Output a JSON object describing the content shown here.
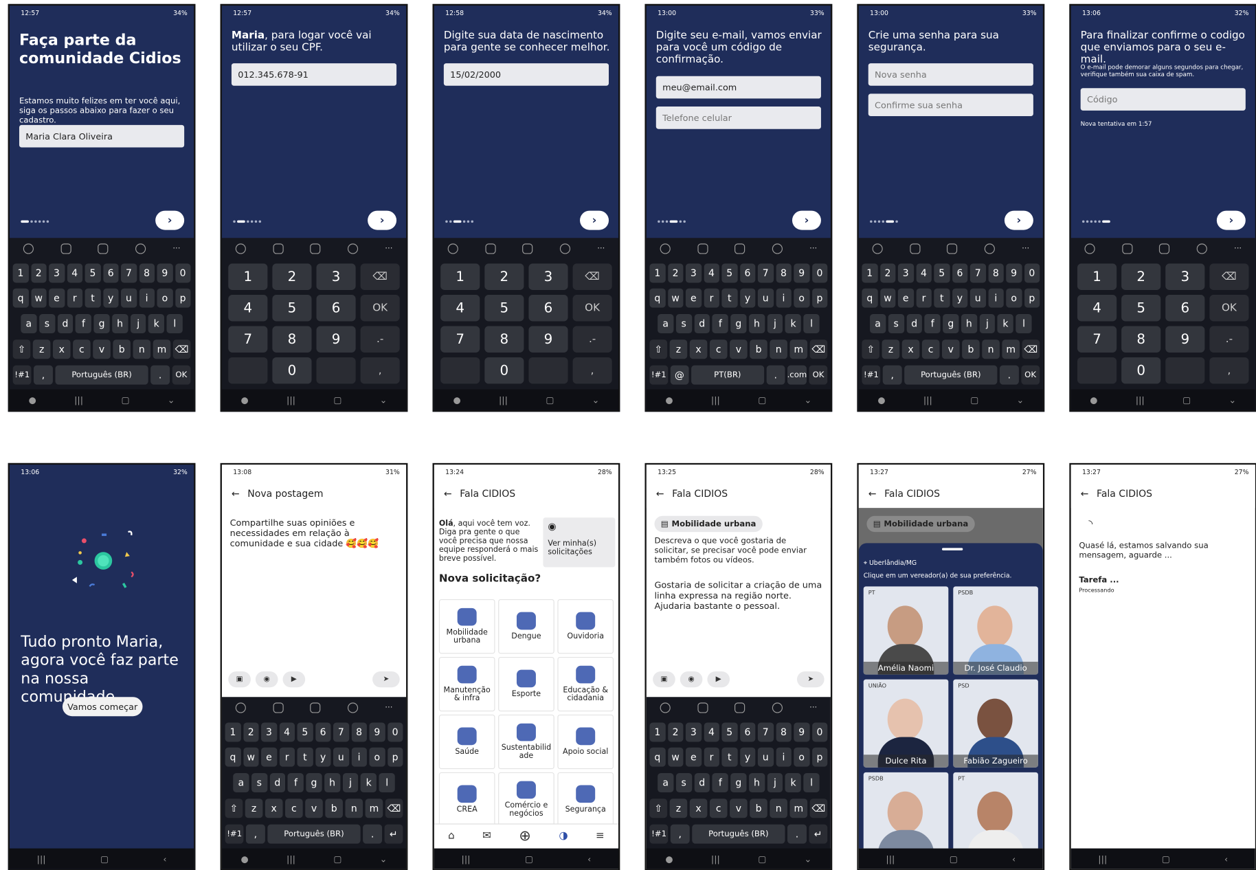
{
  "screens": {
    "s1": {
      "time": "12:57",
      "battery": "34%",
      "title": "Faça parte da comunidade Cidios",
      "subtitle": "Estamos muito felizes em ter você aqui, siga os passos abaixo para fazer o seu cadastro.",
      "name_value": "Maria Clara Oliveira",
      "lang": "Português (BR)",
      "ok": "OK",
      "sym": "!#1"
    },
    "s2": {
      "time": "12:57",
      "battery": "34%",
      "name_bold": "Maria",
      "question": ", para logar você vai utilizar o seu CPF.",
      "cpf_value": "012.345.678-91"
    },
    "s3": {
      "time": "12:58",
      "battery": "34%",
      "question": "Digite sua data de nascimento para gente se conhecer melhor.",
      "date_value": "15/02/2000"
    },
    "s4": {
      "time": "13:00",
      "battery": "33%",
      "question": "Digite seu e-mail, vamos enviar para você um código de confirmação.",
      "email_value": "meu@email.com",
      "phone_placeholder": "Telefone celular",
      "lang": "PT(BR)",
      "com": ".com",
      "at": "@"
    },
    "s5": {
      "time": "13:00",
      "battery": "33%",
      "question": "Crie uma senha para sua segurança.",
      "pass_placeholder": "Nova senha",
      "confirm_placeholder": "Confirme sua senha"
    },
    "s6": {
      "time": "13:06",
      "battery": "32%",
      "question": "Para finalizar confirme o codigo que enviamos para o seu e-mail.",
      "note": "O e-mail pode demorar alguns segundos para chegar, verifique também sua caixa de spam.",
      "code_placeholder": "Código",
      "retry": "Nova tentativa em 1:57"
    },
    "s7": {
      "time": "13:06",
      "battery": "32%",
      "title": "Tudo pronto Maria, agora você faz parte na nossa comunidade.",
      "button": "Vamos começar"
    },
    "s8": {
      "time": "13:08",
      "battery": "31%",
      "header": "Nova postagem",
      "text": "Compartilhe suas opiniões e necessidades em relação à comunidade e sua cidade 🥰🥰🥰"
    },
    "s9": {
      "time": "13:24",
      "battery": "28%",
      "header": "Fala CIDIOS",
      "intro_bold": "Olá",
      "intro": ", aqui você tem voz. Diga pra gente o que você precisa que nossa equipe responderá o mais breve possível.",
      "view_mine": "Ver minha(s) solicitações",
      "new_request": "Nova solicitação?",
      "tiles": [
        "Mobilidade urbana",
        "Dengue",
        "Ouvidoria",
        "Manutenção & infra",
        "Esporte",
        "Educação & cidadania",
        "Saúde",
        "Sustentabilid ade",
        "Apoio social",
        "CREA",
        "Comércio e negócios",
        "Segurança"
      ]
    },
    "s10": {
      "time": "13:25",
      "battery": "28%",
      "header": "Fala CIDIOS",
      "chip": "Mobilidade urbana",
      "prompt": "Descreva o que você gostaria de solicitar, se precisar você pode enviar também fotos ou vídeos.",
      "message": "Gostaria de solicitar a criação de uma linha expressa na região norte. Ajudaria bastante o pessoal."
    },
    "s11": {
      "time": "13:27",
      "battery": "27%",
      "header": "Fala CIDIOS",
      "chip": "Mobilidade urbana",
      "location": "Uberlândia/MG",
      "instruction": "Clique em um vereador(a) de sua preferência.",
      "cards": [
        {
          "party": "PT",
          "name": "Amélia Naomi"
        },
        {
          "party": "PSDB",
          "name": "Dr. José Claudio"
        },
        {
          "party": "UNIÃO",
          "name": "Dulce Rita"
        },
        {
          "party": "PSD",
          "name": "Fabião Zagueiro"
        },
        {
          "party": "PSDB",
          "name": ""
        },
        {
          "party": "PT",
          "name": ""
        }
      ]
    },
    "s12": {
      "time": "13:27",
      "battery": "27%",
      "header": "Fala CIDIOS",
      "message": "Quasé lá, estamos salvando sua mensagem, aguarde ...",
      "task": "Tarefa ...",
      "status": "Processando"
    }
  }
}
